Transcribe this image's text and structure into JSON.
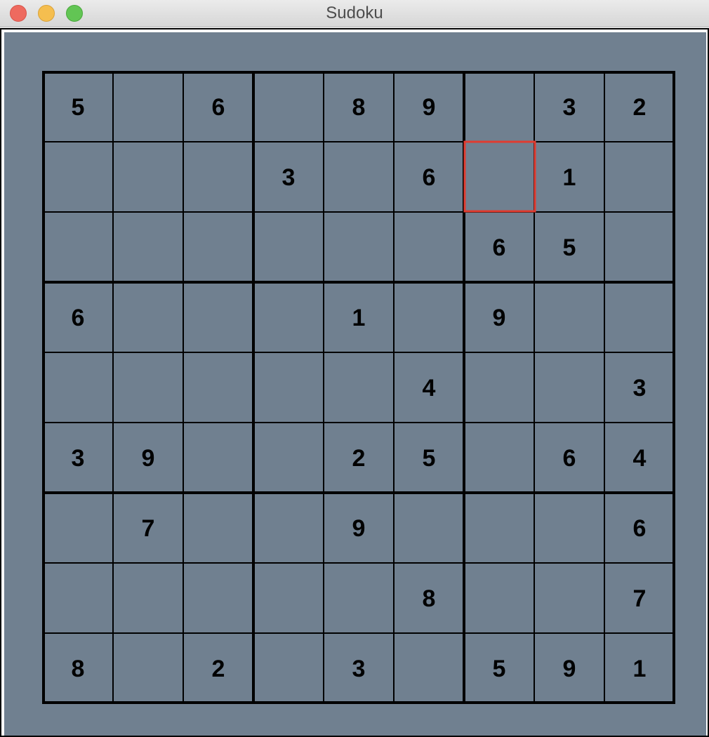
{
  "window": {
    "title": "Sudoku",
    "buttons": [
      "close",
      "minimize",
      "zoom"
    ]
  },
  "board": {
    "background": "#708090",
    "line_color": "#000000",
    "selection_color": "#e03c31",
    "selected_cell": {
      "row": 1,
      "col": 6
    },
    "grid": [
      [
        "5",
        "",
        "6",
        "",
        "8",
        "9",
        "",
        "3",
        "2"
      ],
      [
        "",
        "",
        "",
        "3",
        "",
        "6",
        "",
        "1",
        ""
      ],
      [
        "",
        "",
        "",
        "",
        "",
        "",
        "6",
        "5",
        ""
      ],
      [
        "6",
        "",
        "",
        "",
        "1",
        "",
        "9",
        "",
        ""
      ],
      [
        "",
        "",
        "",
        "",
        "",
        "4",
        "",
        "",
        "3"
      ],
      [
        "3",
        "9",
        "",
        "",
        "2",
        "5",
        "",
        "6",
        "4"
      ],
      [
        "",
        "7",
        "",
        "",
        "9",
        "",
        "",
        "",
        "6"
      ],
      [
        "",
        "",
        "",
        "",
        "",
        "8",
        "",
        "",
        "7"
      ],
      [
        "8",
        "",
        "2",
        "",
        "3",
        "",
        "5",
        "9",
        "1"
      ]
    ]
  }
}
